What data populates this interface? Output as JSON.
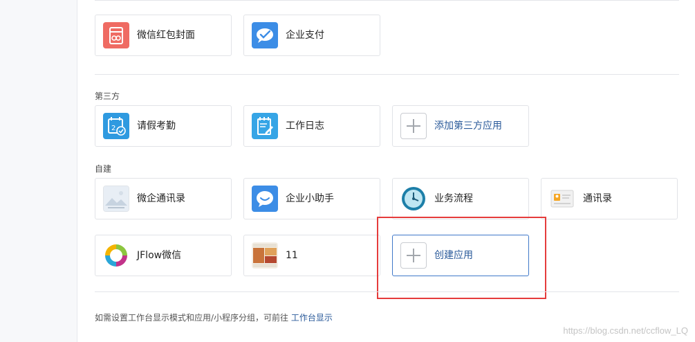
{
  "sections": {
    "top": {
      "cards": [
        {
          "label": "微信红包封面",
          "icon": "red-packet-icon"
        },
        {
          "label": "企业支付",
          "icon": "wechat-pay-icon"
        }
      ]
    },
    "third_party": {
      "title": "第三方",
      "cards": [
        {
          "label": "请假考勤",
          "icon": "calendar-check-icon"
        },
        {
          "label": "工作日志",
          "icon": "journal-icon"
        },
        {
          "label": "添加第三方应用",
          "icon": "plus-icon"
        }
      ]
    },
    "custom": {
      "title": "自建",
      "cards": [
        {
          "label": "微企通讯录",
          "icon": "placeholder-image-icon"
        },
        {
          "label": "企业小助手",
          "icon": "chat-bubble-icon"
        },
        {
          "label": "业务流程",
          "icon": "clock-icon"
        },
        {
          "label": "通讯录",
          "icon": "contact-card-icon"
        },
        {
          "label": "JFlow微信",
          "icon": "flow-cycle-icon"
        },
        {
          "label": "11",
          "icon": "photo-thumbnail-icon"
        },
        {
          "label": "创建应用",
          "icon": "plus-icon"
        }
      ]
    }
  },
  "footer": {
    "text": "如需设置工作台显示模式和应用/小程序分组，可前往",
    "link": "工作台显示"
  },
  "watermark": "https://blog.csdn.net/ccflow_LQ",
  "colors": {
    "accent": "#3f78c9",
    "highlight": "#e53b3b",
    "link": "#2a5a9a"
  }
}
